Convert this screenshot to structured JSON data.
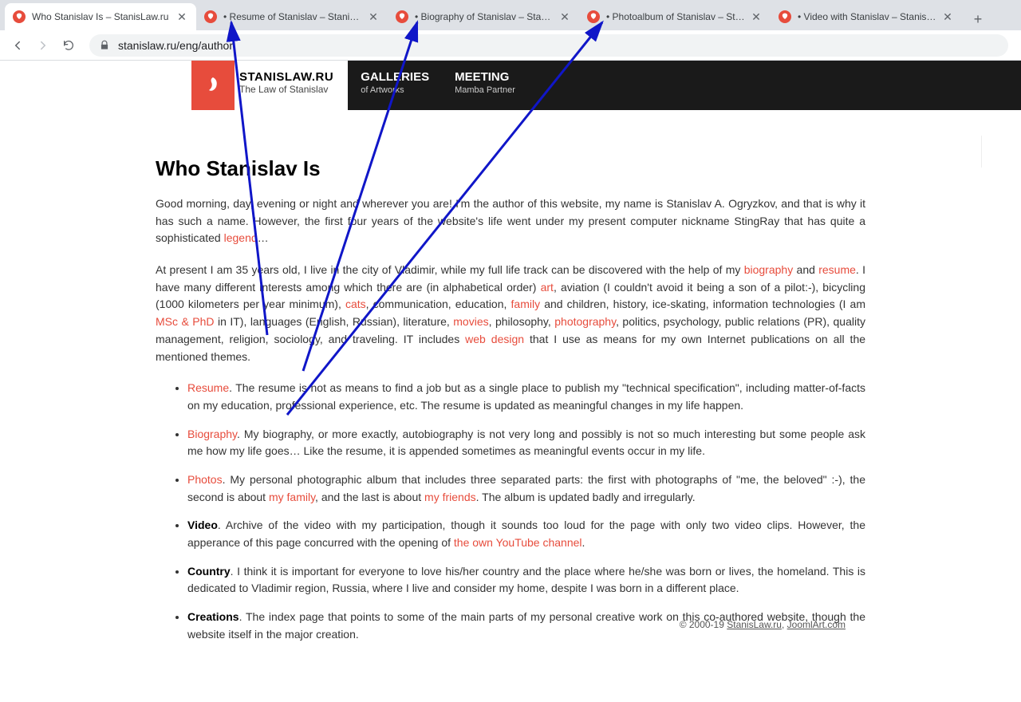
{
  "tabs": [
    {
      "title": "Who Stanislav Is – StanisLaw.ru",
      "active": true
    },
    {
      "title": "• Resume of Stanislav – StanisLaw",
      "active": false
    },
    {
      "title": "• Biography of Stanislav – StanisL",
      "active": false
    },
    {
      "title": "• Photoalbum of Stanislav – Stani",
      "active": false
    },
    {
      "title": "• Video with Stanislav – StanisLav",
      "active": false
    }
  ],
  "url": "stanislaw.ru/eng/author",
  "brand": {
    "name": "STANISLAW.RU",
    "tagline": "The Law of Stanislav"
  },
  "menu": [
    {
      "label": "GALLERIES",
      "sub": "of Artworks"
    },
    {
      "label": "MEETING",
      "sub": "Mamba Partner"
    }
  ],
  "heading": "Who Stanislav Is",
  "para1": {
    "pre": "Good morning, day, evening or night and wherever you are! I'm the author of this website, my name is Stanislav A. Ogryzkov, and that is why it has such a name. However, the first four years of the website's life went under my present computer nickname StingRay that has quite a sophisticated ",
    "legend": "legend",
    "post": "…"
  },
  "para2": {
    "t1": "At present I am 35 years old, I live in the city of Vladimir, while my full life track can be discovered with the help of my ",
    "biography": "biography",
    "t2": " and ",
    "resume": "resume",
    "t3": ". I have many different interests among which there are (in alphabetical order) ",
    "art": "art",
    "t4": ", aviation (I couldn't avoid it being a son of a pilot:-), bicycling (1000 kilometers per year minimum), ",
    "cats": "cats",
    "t5": ", communication, education, ",
    "family": "family",
    "t6": " and children, history, ice-skating, information technologies (I am ",
    "msc": "MSc & PhD",
    "t7": " in IT), languages (English, Russian), literature, ",
    "movies": "movies",
    "t8": ", philosophy, ",
    "photography": "photography",
    "t9": ", politics, psychology, public relations (PR), quality management, religion, sociology, and traveling. IT includes ",
    "webdesign": "web design",
    "t10": " that I use as means for my own Internet publications on all the mentioned themes."
  },
  "items": {
    "resume": {
      "lead": "Resume",
      "text": ". The resume is not as means to find a job but as a single place to publish my \"technical specification\", including matter-of-facts on my education, professional experience, etc. The resume is updated as meaningful changes in my life happen."
    },
    "biography": {
      "lead": "Biography",
      "text": ". My biography, or more exactly, autobiography is not very long and possibly is not so much interesting but some people ask me how my life goes… Like the resume, it is appended sometimes as meaningful events occur in my life."
    },
    "photos": {
      "lead": "Photos",
      "t1": ". My personal photographic album that includes three separated parts: the first with photographs of \"me, the beloved\" :-), the second is about ",
      "myfamily": "my family",
      "t2": ", and the last is about ",
      "myfriends": "my friends",
      "t3": ". The album is updated badly and irregularly."
    },
    "video": {
      "lead": "Video",
      "t1": ". Archive of the video with my participation, though it sounds too loud for the page with only two video clips. However, the apperance of this page concurred with the opening of ",
      "yt": "the own YouTube channel",
      "t2": "."
    },
    "country": {
      "lead": "Country",
      "text": ". I think it is important for everyone to love his/her country and the place where he/she was born or lives, the homeland. This is dedicated to Vladimir region, Russia, where I live and consider my home, despite I was born in a different place."
    },
    "creations": {
      "lead": "Creations",
      "text": ". The index page that points to some of the main parts of my personal creative work on this co-authored website, though the website itself in the major creation."
    }
  },
  "footer": {
    "pre": "© 2000-19 ",
    "l1": "StanisLaw.ru",
    "sep": ", ",
    "l2": "JoomlArt.com"
  }
}
